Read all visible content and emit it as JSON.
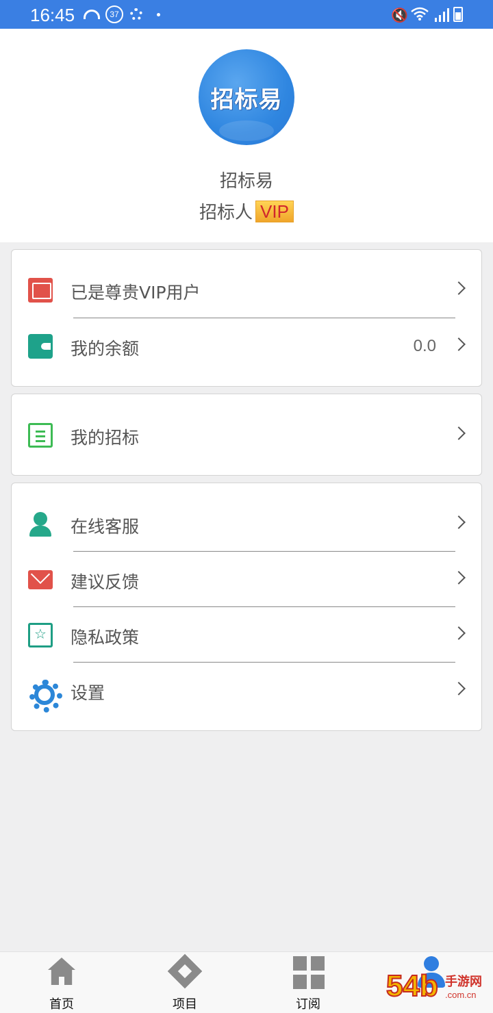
{
  "status_bar": {
    "time": "16:45",
    "badge": "37",
    "icons": [
      "speedometer-icon",
      "notification-badge-icon",
      "gear-icon",
      "dot-icon",
      "mute-icon",
      "wifi-icon",
      "signal-icon",
      "battery-icon"
    ]
  },
  "profile": {
    "avatar_text": "招标易",
    "username": "招标易",
    "role": "招标人",
    "vip_badge": "VIP"
  },
  "cards": [
    {
      "rows": [
        {
          "label": "已是尊贵VIP用户",
          "icon": "vip-card-icon",
          "value": ""
        },
        {
          "label": "我的余额",
          "icon": "wallet-icon",
          "value": "0.0"
        }
      ]
    },
    {
      "rows": [
        {
          "label": "我的招标",
          "icon": "notebook-icon",
          "value": ""
        }
      ]
    },
    {
      "rows": [
        {
          "label": "在线客服",
          "icon": "customer-service-icon",
          "value": ""
        },
        {
          "label": "建议反馈",
          "icon": "mail-icon",
          "value": ""
        },
        {
          "label": "隐私政策",
          "icon": "privacy-book-icon",
          "value": ""
        },
        {
          "label": "设置",
          "icon": "settings-gear-icon",
          "value": ""
        }
      ]
    }
  ],
  "tabbar": {
    "tabs": [
      {
        "label": "首页",
        "icon": "home-icon"
      },
      {
        "label": "项目",
        "icon": "project-icon"
      },
      {
        "label": "订阅",
        "icon": "grid-icon"
      },
      {
        "label": "",
        "icon": "user-icon",
        "active": true
      }
    ]
  },
  "watermark": {
    "number": "54b",
    "text": "手游网",
    "url": ".com.cn"
  },
  "colors": {
    "status_bar": "#3a7fe3",
    "accent": "#2f7ee0",
    "vip_gold": "#f0a52a",
    "vip_text": "#d1262c",
    "page_bg": "#efeff0"
  }
}
